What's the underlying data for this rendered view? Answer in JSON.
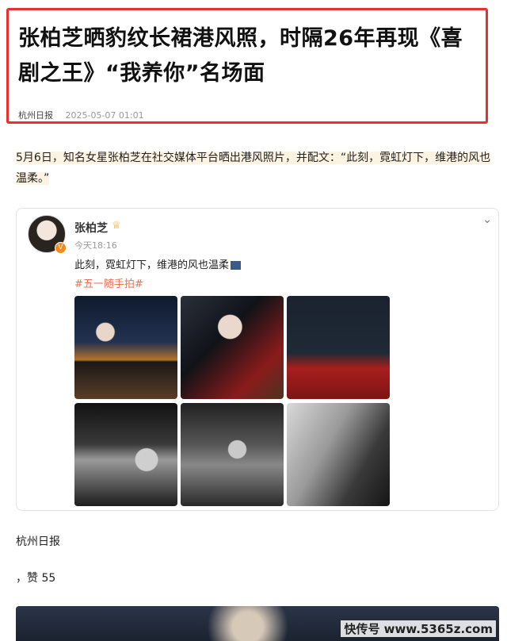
{
  "article": {
    "headline": "张柏芝晒豹纹长裙港风照，时隔26年再现《喜剧之王》“我养你”名场面",
    "source": "杭州日报",
    "date": "2025-05-07 01:01",
    "lead": "5月6日，知名女星张柏芝在社交媒体平台晒出港风照片，并配文：“此刻，霓虹灯下，维港的风也温柔。”"
  },
  "weibo_post": {
    "user_name": "张柏芝",
    "time": "今天18:16",
    "text": "此刻，霓虹灯下，维港的风也温柔",
    "topic": "#五一随手拍#",
    "verified_badge": "V",
    "icons": [
      "crown-icon",
      "chevron-down-icon",
      "verified-badge-icon"
    ]
  },
  "footer": {
    "source_label": "杭州日报",
    "likes": "，赞 55",
    "watermark": "快传号 www.5365z.com"
  },
  "colors": {
    "accent_red": "#e8312f",
    "topic_orange": "#eb7350"
  }
}
